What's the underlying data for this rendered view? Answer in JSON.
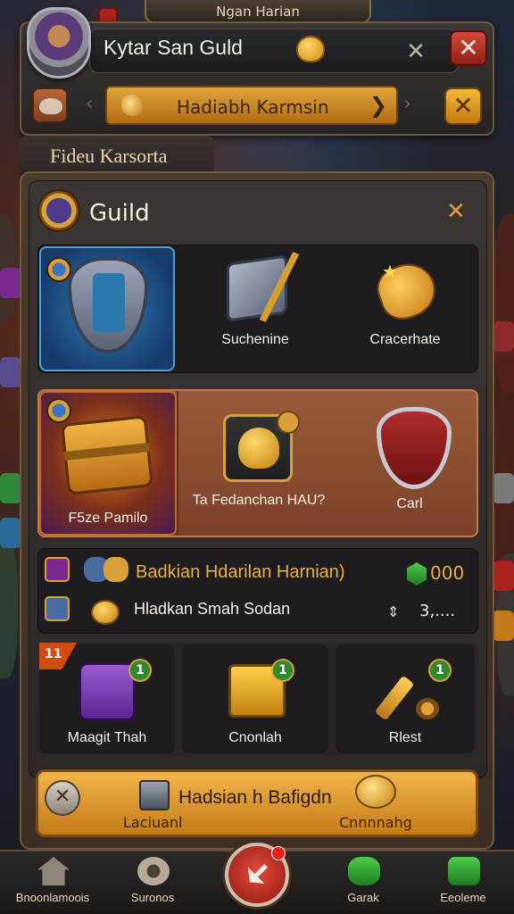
{
  "top_strip": {
    "label": "Ngan Harian"
  },
  "header": {
    "guild_name": "Kytar San Guld",
    "banner_label": "Hadiabh Karmsin",
    "close_dark": "✕",
    "close_red": "✕",
    "close_gold": "✕",
    "banner_arrow": "❯"
  },
  "section_tab": {
    "label": "Fideu Karsorta"
  },
  "panel": {
    "title": "Guild",
    "close": "✕"
  },
  "row1": {
    "tiles": [
      {
        "label": ""
      },
      {
        "label": "Suchenine"
      },
      {
        "label": "Cracerhate"
      }
    ]
  },
  "row2": {
    "tiles": [
      {
        "label": "F5ze Pamilo"
      },
      {
        "label": "Ta Fedanchan HAU?",
        "badge": ""
      },
      {
        "label": "Carl"
      }
    ]
  },
  "row3": {
    "title": "Badkian Hdarilan Harnian)",
    "gems": "000",
    "subtitle": "Hladkan Smah Sodan",
    "value": "3,....",
    "arrow": "⇕"
  },
  "row4": {
    "ribbon": "11",
    "tiles": [
      {
        "label": "Maagit Thah",
        "badge": "1"
      },
      {
        "label": "Cnonlah",
        "badge": "1"
      },
      {
        "label": "Rlest",
        "badge": "1"
      }
    ]
  },
  "footer": {
    "title": "Hadsian h Bafigdn",
    "left_label": "Laciuanl",
    "right_label": "Cnnnnahg",
    "close": "✕"
  },
  "bottom_nav": {
    "items": [
      {
        "label": "Bnoonlamoois"
      },
      {
        "label": "Suronos"
      },
      {
        "label": "Garak"
      },
      {
        "label": "Eeoleme"
      }
    ]
  },
  "colors": {
    "gold": "#e8b13d",
    "accent_red": "#a8231b",
    "panel_brown": "#4a3a2c",
    "gem_green": "#4ccd4a"
  }
}
